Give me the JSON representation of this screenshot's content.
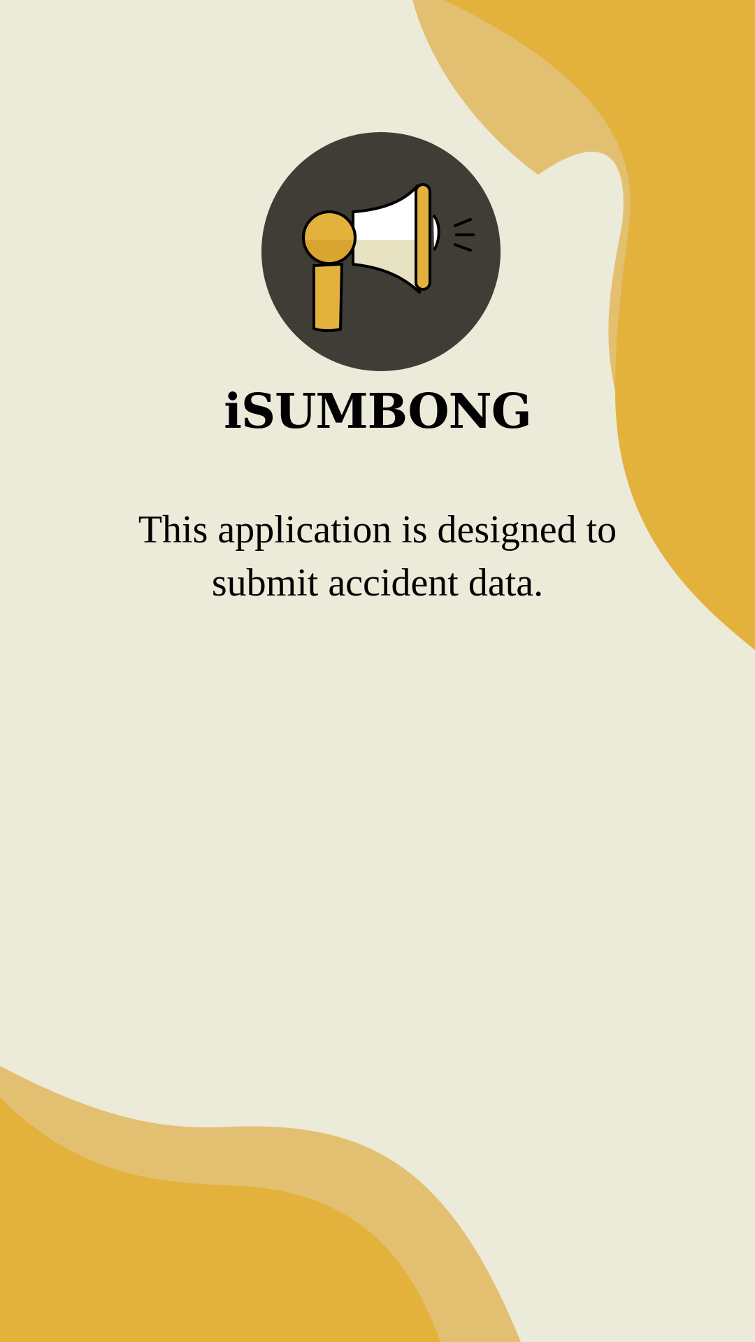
{
  "app": {
    "title": "iSUMBONG",
    "description": "This application is designed to submit accident data."
  },
  "icons": {
    "logo": "megaphone-icon"
  },
  "colors": {
    "background": "#ECEAD9",
    "accent": "#E3B23C",
    "accent_light": "#E3C071",
    "logo_circle": "#403D37",
    "text": "#000000"
  }
}
